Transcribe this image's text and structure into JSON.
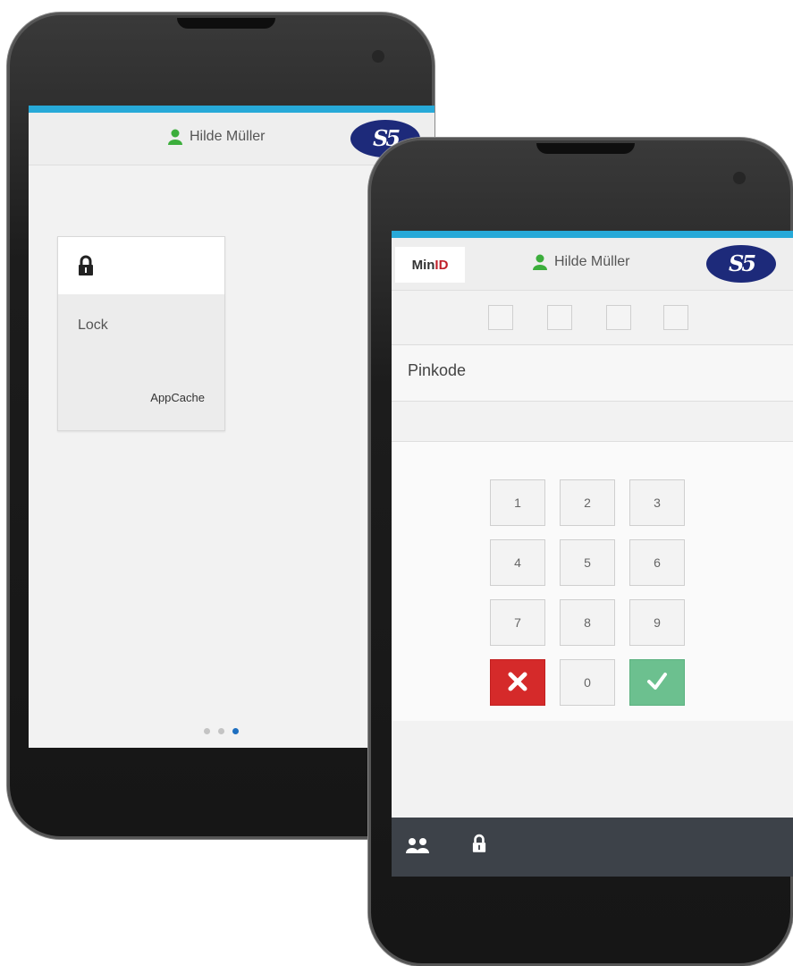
{
  "colors": {
    "accent_bar": "#27a9d8",
    "logo_bg": "#1d2a7a",
    "user_icon": "#3cae3c",
    "cancel": "#d52a2a",
    "confirm": "#6cc08f",
    "bottom_bar": "#3d4249",
    "active_dot": "#1e6fc0"
  },
  "phone1": {
    "header": {
      "user_name": "Hilde Müller",
      "user_icon": "user-icon",
      "logo_text": "S5"
    },
    "tile": {
      "icon": "lock-icon",
      "label": "Lock",
      "sub_label": "AppCache"
    },
    "pager": {
      "total": 3,
      "active_index": 3
    }
  },
  "phone2": {
    "header": {
      "brand_prefix": "Min",
      "brand_suffix": "ID",
      "user_name": "Hilde Müller",
      "user_icon": "user-icon",
      "logo_text": "S5"
    },
    "pin": {
      "digit_boxes": 4,
      "label": "Pinkode",
      "value": ""
    },
    "keypad": {
      "keys": [
        "1",
        "2",
        "3",
        "4",
        "5",
        "6",
        "7",
        "8",
        "9"
      ],
      "zero": "0",
      "cancel_icon": "close-icon",
      "confirm_icon": "check-icon"
    },
    "bottom_bar": {
      "icons": [
        "users-icon",
        "lock-icon"
      ]
    }
  }
}
